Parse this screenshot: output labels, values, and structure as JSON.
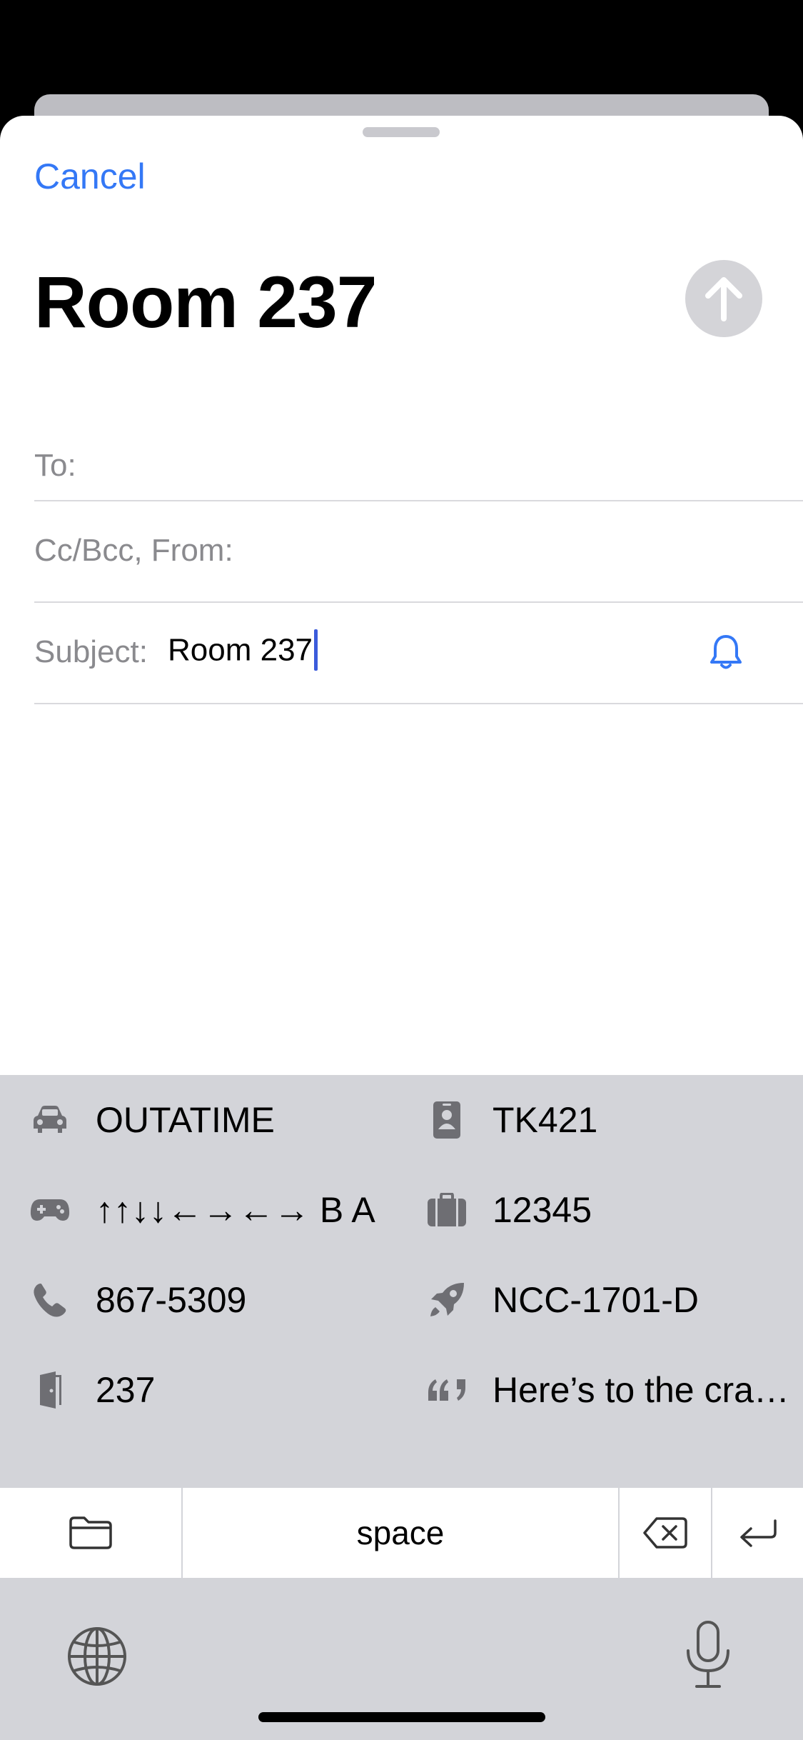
{
  "sheet": {
    "cancel_label": "Cancel",
    "title": "Room 237"
  },
  "fields": {
    "to_label": "To:",
    "cc_label": "Cc/Bcc, From:",
    "subject_label": "Subject:",
    "subject_value": "Room 237"
  },
  "suggestions": [
    {
      "icon": "car-icon",
      "text": "OUTATIME"
    },
    {
      "icon": "id-badge-icon",
      "text": "TK421"
    },
    {
      "icon": "gamepad-icon",
      "text": "↑↑↓↓←→←→ B A"
    },
    {
      "icon": "briefcase-icon",
      "text": "12345"
    },
    {
      "icon": "phone-icon",
      "text": "867-5309"
    },
    {
      "icon": "rocket-icon",
      "text": "NCC-1701-D"
    },
    {
      "icon": "door-icon",
      "text": "237"
    },
    {
      "icon": "quote-icon",
      "text": "Here’s to the cra…"
    }
  ],
  "keyboard": {
    "space_label": "space"
  },
  "colors": {
    "accent": "#3478f6",
    "keyboard_bg": "#d3d4d9",
    "icon_gray": "#6e6e73"
  }
}
